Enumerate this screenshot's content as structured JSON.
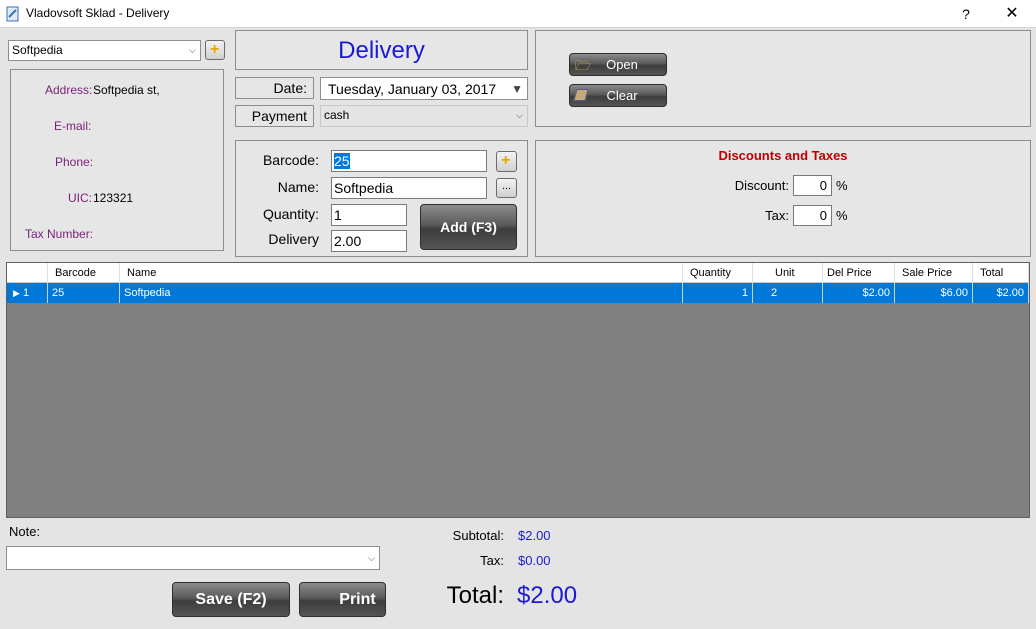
{
  "window": {
    "title": "Vladovsoft Sklad - Delivery",
    "help": "?",
    "close": "✕"
  },
  "supplier": {
    "selected": "Softpedia",
    "labels": {
      "address": "Address:",
      "email": "E-mail:",
      "phone": "Phone:",
      "uic": "UIC:",
      "tax_number": "Tax Number:"
    },
    "values": {
      "address": "Softpedia st,",
      "uic": "123321"
    }
  },
  "header": {
    "title": "Delivery",
    "date_label": "Date:",
    "date_value": "Tuesday, January 03, 2017",
    "payment_label": "Payment",
    "payment_value": "cash"
  },
  "actions": {
    "open": "Open",
    "clear": "Clear"
  },
  "entry": {
    "barcode_label": "Barcode:",
    "barcode_value": "25",
    "name_label": "Name:",
    "name_value": "Softpedia",
    "browse": "...",
    "quantity_label": "Quantity:",
    "quantity_value": "1",
    "delivery_label": "Delivery",
    "delivery_value": "2.00",
    "add_button": "Add (F3)"
  },
  "discounts": {
    "title": "Discounts and Taxes",
    "discount_label": "Discount:",
    "discount_value": "0",
    "tax_label": "Tax:",
    "tax_value": "0",
    "percent": "%"
  },
  "grid": {
    "columns": [
      "Barcode",
      "Name",
      "Quantity",
      "Unit",
      "Del Price",
      "Sale Price",
      "Total"
    ],
    "rows": [
      {
        "index": "1",
        "barcode": "25",
        "name": "Softpedia",
        "quantity": "1",
        "unit": "2",
        "del_price": "$2.00",
        "sale_price": "$6.00",
        "total": "$2.00"
      }
    ]
  },
  "note": {
    "label": "Note:",
    "value": ""
  },
  "totals": {
    "subtotal_label": "Subtotal:",
    "subtotal_value": "$2.00",
    "tax_label": "Tax:",
    "tax_value": "$0.00",
    "total_label": "Total:",
    "total_value": "$2.00"
  },
  "buttons": {
    "save": "Save (F2)",
    "print": "Print"
  },
  "colors": {
    "accent_blue": "#1a1ad6",
    "label_purple": "#7a1f7a",
    "discount_red": "#c00000",
    "selection": "#0078d7"
  }
}
